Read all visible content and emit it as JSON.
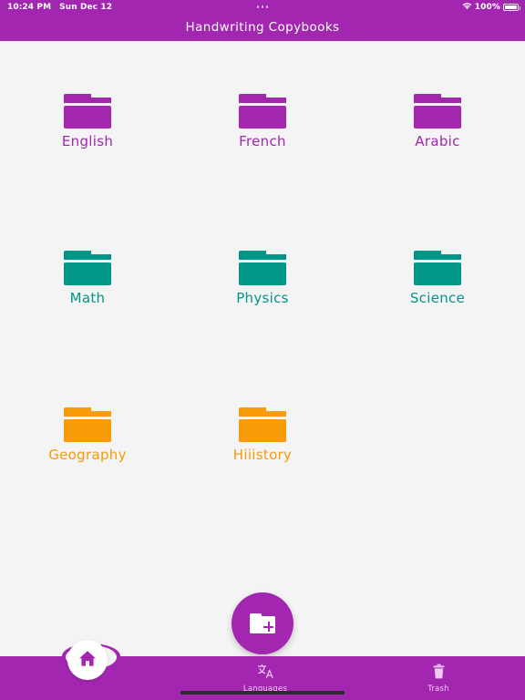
{
  "status_bar": {
    "time": "10:24 PM",
    "date": "Sun Dec 12",
    "battery_percent": "100%",
    "wifi_icon": "wifi-icon",
    "battery_icon": "battery-icon",
    "dots_icon": "dynamic-island-dots"
  },
  "header": {
    "title": "Handwriting Copybooks",
    "background_color": "#a226b0"
  },
  "colors": {
    "purple": "#a226b0",
    "teal": "#00968a",
    "orange": "#f99a07",
    "page_background": "#f4f4f4",
    "nav_label": "#eec9f2"
  },
  "folders": [
    [
      {
        "label": "English",
        "color": "#a226b0",
        "icon": "folder-icon"
      },
      {
        "label": "French",
        "color": "#a226b0",
        "icon": "folder-icon"
      },
      {
        "label": "Arabic",
        "color": "#a226b0",
        "icon": "folder-icon"
      }
    ],
    [
      {
        "label": "Math",
        "color": "#00968a",
        "icon": "folder-icon"
      },
      {
        "label": "Physics",
        "color": "#00968a",
        "icon": "folder-icon"
      },
      {
        "label": "Science",
        "color": "#00968a",
        "icon": "folder-icon"
      }
    ],
    [
      {
        "label": "Geography",
        "color": "#f99a07",
        "icon": "folder-icon"
      },
      {
        "label": "Hiiistory",
        "color": "#f99a07",
        "icon": "folder-icon"
      },
      {
        "label": "",
        "color": "#f99a07",
        "icon": "folder-icon",
        "empty": true
      }
    ]
  ],
  "fab": {
    "icon": "add-folder-icon",
    "color": "#a226b0"
  },
  "bottom_nav": {
    "home": {
      "icon": "home-icon"
    },
    "items": [
      {
        "label": "Languages",
        "icon": "translate-icon"
      },
      {
        "label": "Trash",
        "icon": "trash-icon"
      }
    ]
  }
}
